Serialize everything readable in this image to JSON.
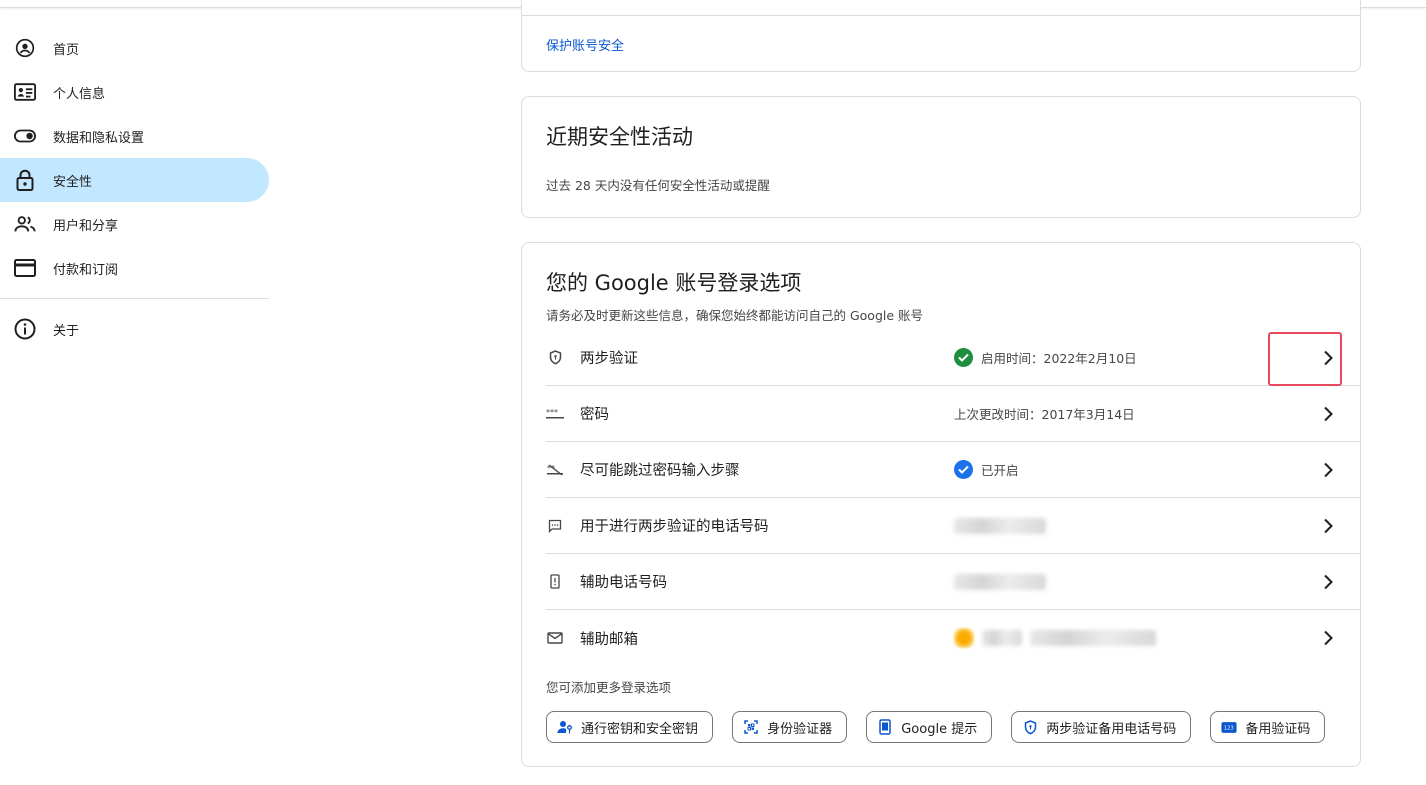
{
  "sidebar": {
    "items": [
      {
        "label": "首页",
        "icon": "account-circle-icon"
      },
      {
        "label": "个人信息",
        "icon": "id-card-icon"
      },
      {
        "label": "数据和隐私设置",
        "icon": "toggle-icon"
      },
      {
        "label": "安全性",
        "icon": "lock-icon",
        "active": true
      },
      {
        "label": "用户和分享",
        "icon": "people-icon"
      },
      {
        "label": "付款和订阅",
        "icon": "credit-card-icon"
      }
    ],
    "footer_items": [
      {
        "label": "关于",
        "icon": "info-icon"
      }
    ]
  },
  "card_protect": {
    "link": "保护账号安全"
  },
  "card_activity": {
    "title": "近期安全性活动",
    "desc": "过去 28 天内没有任何安全性活动或提醒"
  },
  "card_signin": {
    "title": "您的 Google 账号登录选项",
    "desc": "请务必及时更新这些信息，确保您始终都能访问自己的 Google 账号",
    "rows": [
      {
        "label": "两步验证",
        "icon": "shield-icon",
        "status": "启用时间：2022年2月10日",
        "status_icon": "green-check-icon"
      },
      {
        "label": "密码",
        "icon": "password-dots-icon",
        "status": "上次更改时间：2017年3月14日"
      },
      {
        "label": "尽可能跳过密码输入步骤",
        "icon": "skip-password-icon",
        "status": "已开启",
        "status_icon": "blue-check-icon"
      },
      {
        "label": "用于进行两步验证的电话号码",
        "icon": "sms-icon",
        "status": ""
      },
      {
        "label": "辅助电话号码",
        "icon": "phone-icon",
        "status": ""
      },
      {
        "label": "辅助邮箱",
        "icon": "mail-icon",
        "status": ""
      }
    ],
    "more_label": "您可添加更多登录选项",
    "chips": [
      {
        "label": "通行密钥和安全密钥",
        "icon": "passkey-icon"
      },
      {
        "label": "身份验证器",
        "icon": "authenticator-qr-icon"
      },
      {
        "label": "Google 提示",
        "icon": "phone-prompt-icon"
      },
      {
        "label": "两步验证备用电话号码",
        "icon": "shield-icon"
      },
      {
        "label": "备用验证码",
        "icon": "backup-code-icon"
      }
    ]
  },
  "colors": {
    "accent": "#0b57d0",
    "active_nav": "#c2e7ff",
    "success": "#1e8e3e",
    "highlight": "#e8495f"
  }
}
